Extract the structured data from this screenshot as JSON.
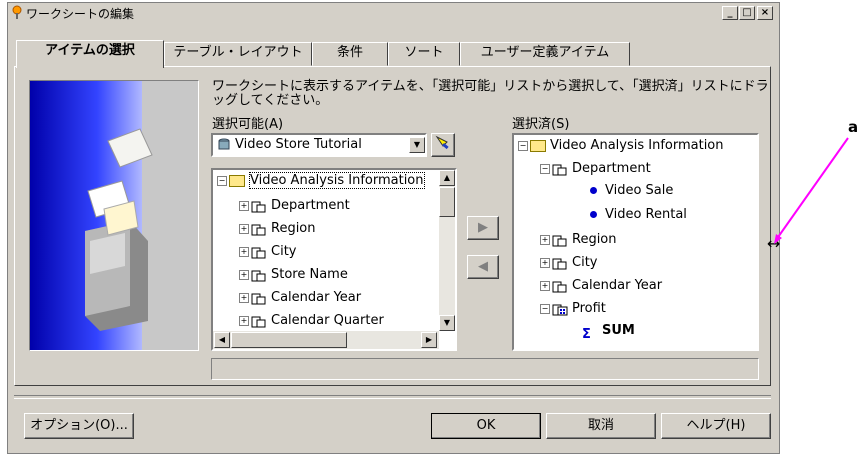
{
  "window": {
    "title": "ワークシートの編集",
    "controls": [
      "_",
      "□",
      "×"
    ]
  },
  "tabs": [
    {
      "label": "アイテムの選択",
      "active": true
    },
    {
      "label": "テーブル・レイアウト"
    },
    {
      "label": "条件"
    },
    {
      "label": "ソート"
    },
    {
      "label": "ユーザー定義アイテム"
    }
  ],
  "instructions": "ワークシートに表示するアイテムを、「選択可能」リストから選択して、「選択済」リストにドラッグしてください。",
  "available": {
    "label": "選択可能(A)",
    "dropdown_value": "Video Store Tutorial",
    "root": "Video Analysis Information",
    "items": [
      "Department",
      "Region",
      "City",
      "Store Name",
      "Calendar Year",
      "Calendar Quarter"
    ]
  },
  "selected": {
    "label": "選択済(S)",
    "root": "Video Analysis Information",
    "department": "Department",
    "department_children": [
      "Video Sale",
      "Video Rental"
    ],
    "items": [
      "Region",
      "City",
      "Calendar Year"
    ],
    "profit": "Profit",
    "profit_child": "SUM"
  },
  "buttons": {
    "options": "オプション(O)...",
    "ok": "OK",
    "cancel": "取消",
    "help": "ヘルプ(H)"
  },
  "annotation": {
    "label": "a",
    "color": "#ff00ff"
  },
  "colors": {
    "dialog_bg": "#d4d0c8",
    "wizard_blue": "#0000ff"
  }
}
